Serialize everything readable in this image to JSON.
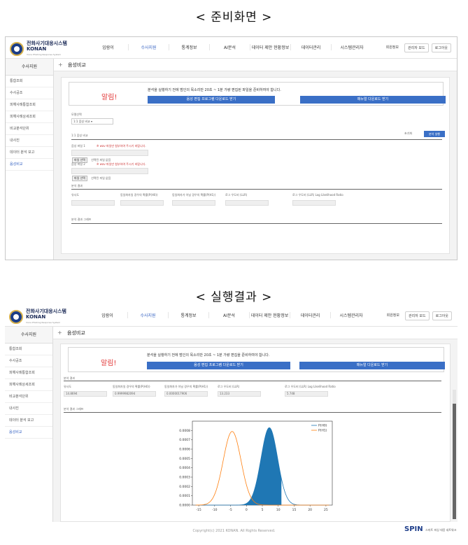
{
  "headings": {
    "prep": "< 준비화면 >",
    "result": "< 실행결과 >"
  },
  "logo": {
    "line1": "전화사기대응시스템",
    "line2": "KONAN",
    "line3": "Voice Phishing Response System"
  },
  "nav": [
    "입람이",
    "수사지원",
    "통계정보",
    "AI분석",
    "데이터 제안 현황정보",
    "데이터관리",
    "시스템관리자"
  ],
  "util": {
    "mypage": "회원정보",
    "manage": "관리자 모드",
    "logout": "로그아웃"
  },
  "sidebar": {
    "head": "수사지원",
    "items": [
      "통합조회",
      "수사공조",
      "피해사례통합조회",
      "피해사례상세조회",
      "비교분석단위",
      "내사진",
      "데이터 분석 보고",
      "음성비교"
    ],
    "active_index": 7
  },
  "page_title": "음성비교",
  "alert": {
    "label": "알림!",
    "msg_prep": "분석을 실행하기 전에 범인의 목소리만 20초 ~ 1분 가량 편집된 파일을 준비하여야 합니다.",
    "msg_result": "분석을 실행하기 전에 범인의 목소리만 20초 ~ 1분 가량 편집을 준비하여야 합니다.",
    "btn_program": "음성 편집 프로그램 다운로드 받기",
    "btn_manual": "매뉴얼 다운로드 받기"
  },
  "prep": {
    "model_label": "모델선택",
    "model_value": "1:1 음성 비교",
    "upload_header": "1:1 음성 비교",
    "refresh": "초기화",
    "analyze": "분석 실행",
    "file1_label": "음성 파일 1",
    "file2_label": "음성 파일 2",
    "note": "※ wav 파일만 첨부하여 주시기 바랍니다.",
    "file_btn": "파일 선택",
    "no_file": "선택된 파일 없음",
    "result_header": "분석 결과",
    "result_cols": [
      "유사도",
      "동일화자일 경우의 확률(P(H0))",
      "동일화자가 아닐 경우의 확률(P(H1))",
      "로그 우도비 (LLR)",
      "로그 우도비 (LLR) Log Likelihood Ratio"
    ],
    "graph_header": "분석 결과 그래프"
  },
  "result": {
    "result_header": "분석 결과",
    "cols": [
      "유사도",
      "동일화자일 경우의 확률(P(H0))",
      "동일화자가 아닐 경우의 확률(P(H1))",
      "로그 우도비 (LLR)",
      "로그 우도비 (LLR) Log Likelihood Ratio"
    ],
    "values": [
      "14.8694",
      "0.9999982094",
      "0.0000017906",
      "13.233",
      "5.748"
    ],
    "graph_header": "분석 결과 그래프"
  },
  "chart_data": {
    "type": "line",
    "title": "",
    "xlabel": "",
    "ylabel": "",
    "xlim": [
      -17,
      27
    ],
    "ylim": [
      0,
      0.0009
    ],
    "xticks": [
      "-15",
      "-10",
      "-5",
      "0",
      "5",
      "10",
      "15",
      "20",
      "25"
    ],
    "yticks": [
      "0.0000",
      "0.0001",
      "0.0002",
      "0.0003",
      "0.0004",
      "0.0005",
      "0.0006",
      "0.0007",
      "0.0008"
    ],
    "legend_loc": "top-right",
    "series": [
      {
        "name": "P(H0)",
        "color": "#1f77b4",
        "mean": 7.2,
        "sd": 2.6,
        "peak": 0.00083,
        "shaded_to": 11
      },
      {
        "name": "P(H1)",
        "color": "#ff7f0e",
        "mean": -4.5,
        "sd": 2.8,
        "peak": 0.00079
      }
    ]
  },
  "footer": {
    "copyright": "Copyright(c) 2021 KONAN. All Rights Reserved.",
    "brand": "SPIN",
    "brand_sub": "스마트 피싱 대응 네트워크"
  }
}
